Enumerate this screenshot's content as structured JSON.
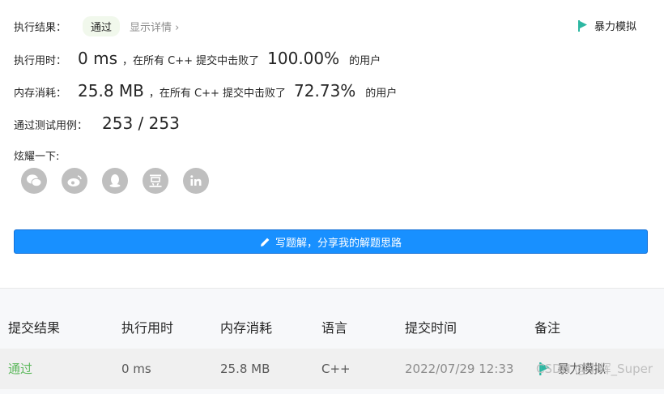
{
  "result": {
    "label": "执行结果：",
    "status": "通过",
    "detail_link": "显示详情 ›",
    "tag": "暴力模拟"
  },
  "runtime": {
    "label": "执行用时：",
    "value": "0 ms",
    "mid": "，在所有 C++ 提交中击败了",
    "percent": "100.00%",
    "suffix": "的用户"
  },
  "memory": {
    "label": "内存消耗：",
    "value": "25.8 MB",
    "mid": "，在所有 C++ 提交中击败了",
    "percent": "72.73%",
    "suffix": "的用户"
  },
  "tests": {
    "label": "通过测试用例：",
    "value": "253 / 253"
  },
  "share": {
    "label": "炫耀一下:",
    "icons": [
      "wechat-icon",
      "weibo-icon",
      "qq-icon",
      "douban-icon",
      "linkedin-icon"
    ]
  },
  "write_button": {
    "label": "写题解，分享我的解题思路"
  },
  "table": {
    "headers": [
      "提交结果",
      "执行用时",
      "内存消耗",
      "语言",
      "提交时间",
      "备注"
    ],
    "row": {
      "status": "通过",
      "runtime": "0 ms",
      "memory": "25.8 MB",
      "language": "C++",
      "time": "2022/07/29 12:33",
      "note": "暴力模拟"
    },
    "watermark": "CSDN @小辉_Super"
  },
  "colors": {
    "accent": "#1890ff",
    "success": "#5cb85c",
    "flag": "#2db7a2"
  }
}
